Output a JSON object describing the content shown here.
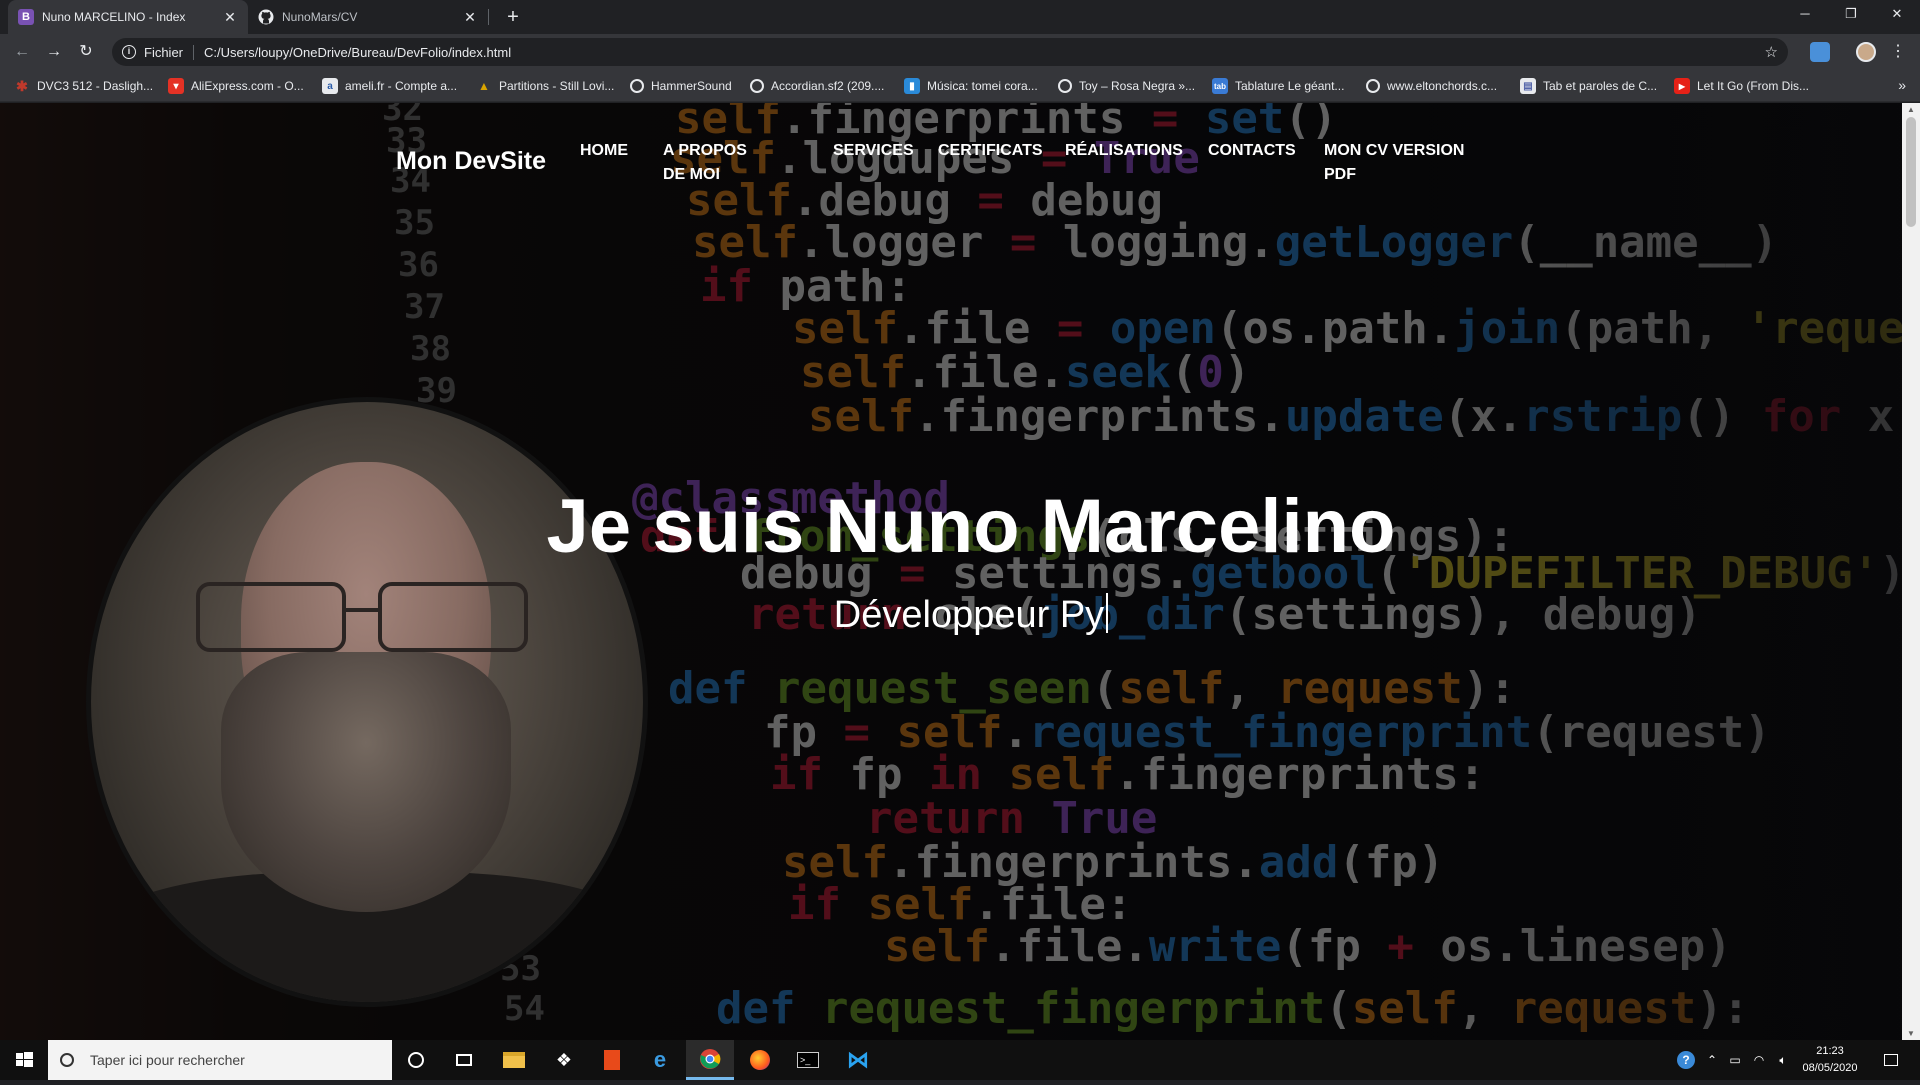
{
  "browser": {
    "tabs": [
      {
        "title": "Nuno MARCELINO - Index",
        "favicon": "B",
        "active": true
      },
      {
        "title": "NunoMars/CV",
        "favicon": "github-icon",
        "active": false
      }
    ],
    "address": {
      "scheme": "Fichier",
      "url": "C:/Users/loupy/OneDrive/Bureau/DevFolio/index.html"
    },
    "bookmarks": [
      {
        "label": "DVC3 512 - Dasligh...",
        "color": "#c0392b"
      },
      {
        "label": "AliExpress.com - O...",
        "color": "#e43225"
      },
      {
        "label": "ameli.fr - Compte a...",
        "color": "#2a5ba8"
      },
      {
        "label": "Partitions - Still Lovi...",
        "color": "#d9a400"
      },
      {
        "label": "HammerSound",
        "color": "#666666"
      },
      {
        "label": "Accordian.sf2 (209....",
        "color": "#666666"
      },
      {
        "label": "Música: tomei cora...",
        "color": "#2a8ad8"
      },
      {
        "label": "Toy – Rosa Negra »...",
        "color": "#666666"
      },
      {
        "label": "Tablature Le géant...",
        "color": "#3a7bd5"
      },
      {
        "label": "www.eltonchords.c...",
        "color": "#666666"
      },
      {
        "label": "Tab et paroles de C...",
        "color": "#5566aa"
      },
      {
        "label": "Let It Go (From Dis...",
        "color": "#e62117"
      }
    ]
  },
  "site": {
    "brand": "Mon DevSite",
    "nav": [
      {
        "label": "HOME"
      },
      {
        "label": "A PROPOS DE MOI"
      },
      {
        "label": "SERVICES"
      },
      {
        "label": "CERTIFICATS"
      },
      {
        "label": "RÉALISATIONS"
      },
      {
        "label": "CONTACTS"
      },
      {
        "label": "MON CV VERSION PDF"
      }
    ],
    "hero": {
      "title": "Je suis Nuno Marcelino",
      "subtitle": "Développeur Py"
    }
  },
  "taskbar": {
    "search_placeholder": "Taper ici pour rechercher",
    "time": "21:23",
    "date": "08/05/2020"
  }
}
